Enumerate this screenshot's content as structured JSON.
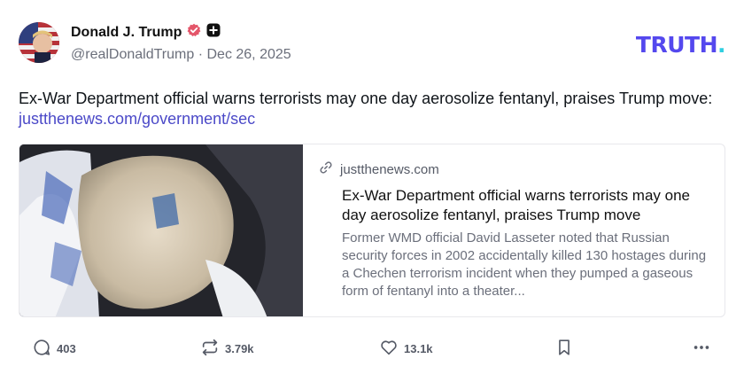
{
  "author": {
    "display_name": "Donald J. Trump",
    "handle": "@realDonaldTrump",
    "separator": " · ",
    "date": "Dec 26, 2025",
    "verified_icon": "verified-badge-icon",
    "plus_icon": "plus-badge-icon"
  },
  "brand": {
    "logo_text": "TRUTH",
    "logo_dot": ".",
    "accent_color": "#5448ee",
    "dot_color": "#2fcfe0"
  },
  "post": {
    "text": "Ex-War Department official warns terrorists may one day aerosolize fentanyl, praises Trump move: ",
    "link_text": "justthenews.com/government/sec",
    "link_color": "#4b49c8"
  },
  "card": {
    "domain": "justthenews.com",
    "title": "Ex-War Department official warns terrorists may one day aerosolize fentanyl, praises Trump move",
    "description": "Former WMD official David Lasseter noted that Russian security forces in 2002 accidentally killed 130 hostages during a Chechen terrorism incident when they pumped a gaseous form of fentanyl into a theater..."
  },
  "actions": {
    "reply_count": "403",
    "retruth_count": "3.79k",
    "like_count": "13.1k"
  }
}
